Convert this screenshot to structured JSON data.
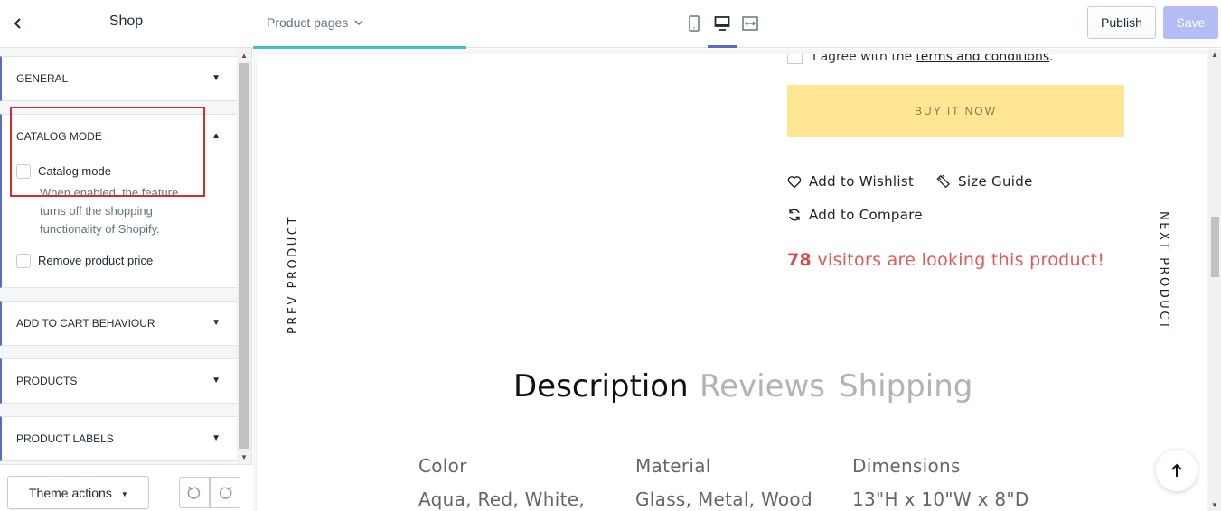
{
  "sidebar": {
    "title": "Shop",
    "sections": [
      {
        "label": "GENERAL"
      },
      {
        "label": "CATALOG MODE"
      },
      {
        "label": "ADD TO CART BEHAVIOUR"
      },
      {
        "label": "PRODUCTS"
      },
      {
        "label": "PRODUCT LABELS"
      }
    ],
    "catalog": {
      "option1_label": "Catalog mode",
      "option1_help_l1": "When enabled, the feature",
      "option1_help_l2": "turns off the shopping",
      "option1_help_l3": "functionality of Shopify.",
      "option2_label": "Remove product price"
    },
    "footer": {
      "theme_actions_label": "Theme actions"
    }
  },
  "topbar": {
    "page_selector": "Product pages",
    "publish_label": "Publish",
    "save_label": "Save",
    "accent_color": "#5c6ac4"
  },
  "preview": {
    "agree_prefix": "I agree with the",
    "agree_link": "terms and conditions",
    "agree_suffix": ".",
    "buy_now": "BUY IT NOW",
    "wishlist": "Add to Wishlist",
    "size_guide": "Size Guide",
    "compare": "Add to Compare",
    "visitors_count": "78",
    "visitors_text": " visitors are looking this product!",
    "prev_product": "PREV PRODUCT",
    "next_product": "NEXT PRODUCT",
    "tabs": [
      "Description",
      "Reviews",
      "Shipping"
    ],
    "specs": [
      {
        "heading": "Color",
        "value": "Aqua, Red, White,"
      },
      {
        "heading": "Material",
        "value": "Glass, Metal, Wood"
      },
      {
        "heading": "Dimensions",
        "value": "13\"H x 10\"W x 8\"D"
      }
    ]
  }
}
